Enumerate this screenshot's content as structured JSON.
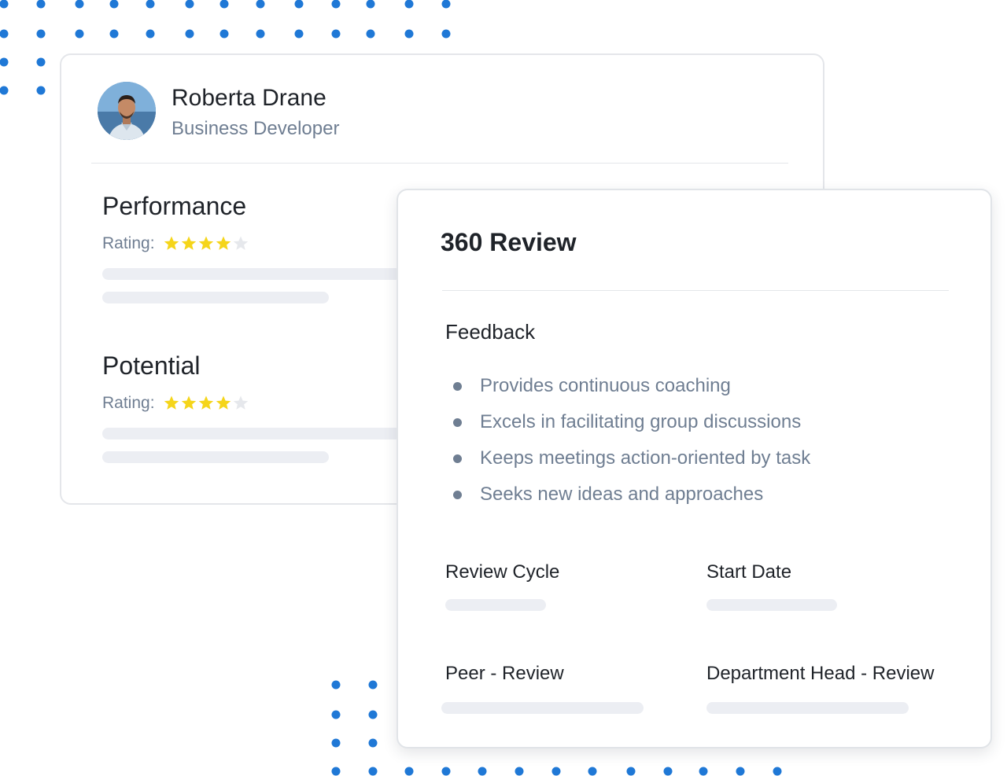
{
  "colors": {
    "dot_blue": "#1f78d6",
    "star_filled": "#f5d51a",
    "star_empty": "#e6e8ec",
    "text_dark": "#1f2329",
    "text_muted": "#6f7e92",
    "skeleton": "#eceef3"
  },
  "profile": {
    "name": "Roberta Drane",
    "role": "Business Developer",
    "avatar_icon": "user-photo"
  },
  "performance": {
    "title": "Performance",
    "rating_label": "Rating:",
    "stars_filled": 4,
    "stars_total": 5
  },
  "potential": {
    "title": "Potential",
    "rating_label": "Rating:",
    "stars_filled": 4,
    "stars_total": 5
  },
  "review": {
    "title": "360 Review",
    "feedback_title": "Feedback",
    "feedback_items": [
      "Provides continuous coaching",
      "Excels in facilitating group discussions",
      "Keeps meetings action-oriented by task",
      "Seeks new ideas and approaches"
    ],
    "fields": {
      "review_cycle": "Review Cycle",
      "start_date": "Start Date",
      "peer_review": "Peer - Review",
      "department_head_review": "Department Head - Review"
    }
  }
}
